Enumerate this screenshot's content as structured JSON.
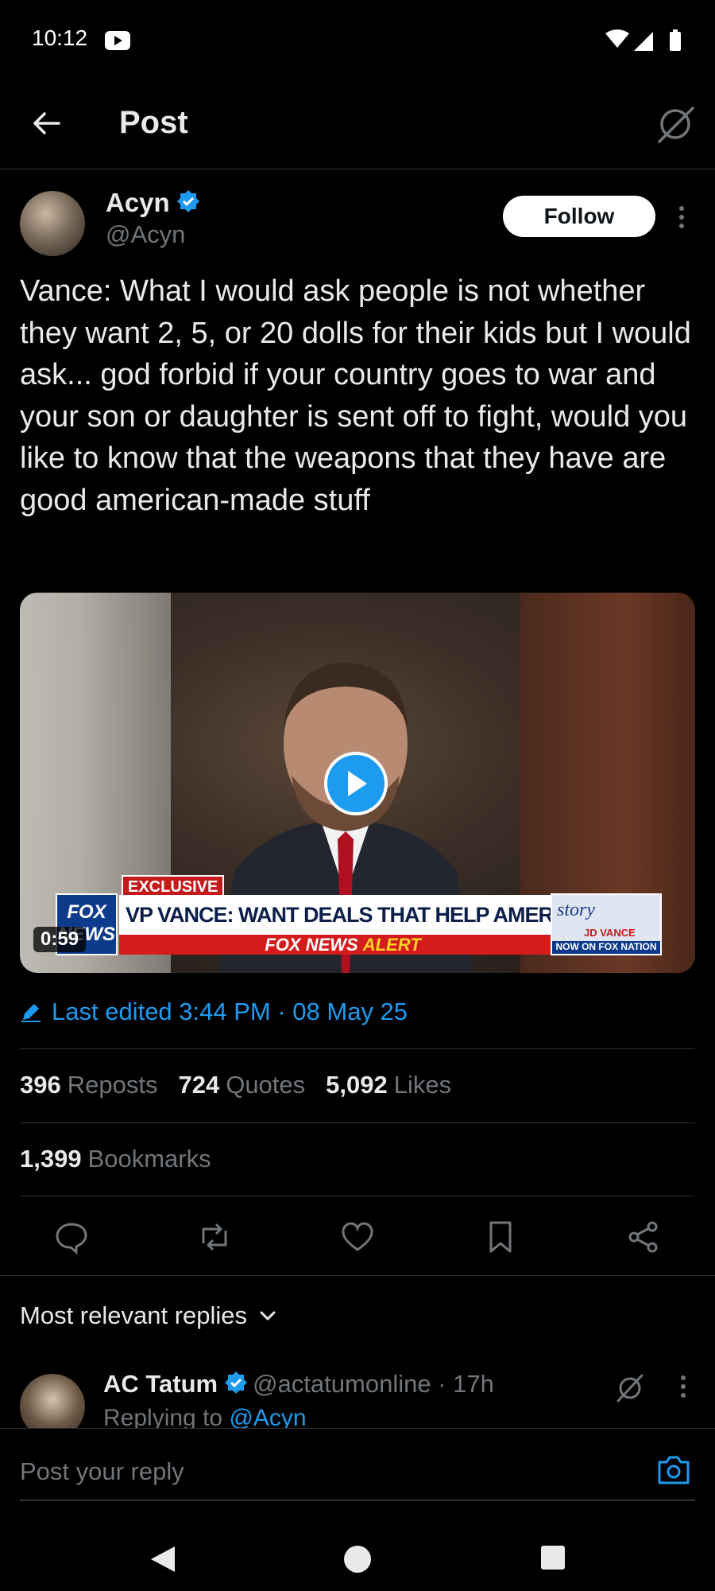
{
  "status_bar": {
    "time": "10:12"
  },
  "header": {
    "title": "Post"
  },
  "author": {
    "name": "Acyn",
    "handle": "@Acyn",
    "follow_label": "Follow"
  },
  "post": {
    "text": "Vance: What I would ask people is not whether they want 2, 5, or 20 dolls for their kids but I would ask... god forbid if your country goes to war and your son or daughter is sent off to fight, would you like to know that the weapons that they have are good american-made stuff",
    "video": {
      "duration": "0:59",
      "chyron_tag": "EXCLUSIVE",
      "chyron_headline": "VP VANCE: WANT DEALS THAT HELP AMERICAN WORKERS",
      "chyron_alert_a": "FOX NEWS",
      "chyron_alert_b": "ALERT",
      "logo_text_1": "FOX",
      "logo_text_2": "NEWS",
      "story_word": "story",
      "story_name": "JD VANCE",
      "story_now": "NOW ON FOX NATION"
    },
    "edited_text": "Last edited 3:44 PM · 08 May 25"
  },
  "stats": {
    "reposts": {
      "count": "396",
      "label": "Reposts"
    },
    "quotes": {
      "count": "724",
      "label": "Quotes"
    },
    "likes": {
      "count": "5,092",
      "label": "Likes"
    },
    "bookmarks": {
      "count": "1,399",
      "label": "Bookmarks"
    }
  },
  "actions": [
    "reply-icon",
    "repost-icon",
    "like-icon",
    "bookmark-icon",
    "share-icon"
  ],
  "replies": {
    "sort_label": "Most relevant replies",
    "first": {
      "name": "AC Tatum",
      "meta": "@actatumonline · 17h",
      "context_prefix": "Replying to ",
      "context_handle": "@Acyn"
    }
  },
  "composer": {
    "placeholder": "Post your reply"
  },
  "colors": {
    "accent": "#1d9bf0",
    "background": "#000000",
    "muted": "#71767b",
    "text": "#e7e9ea"
  }
}
